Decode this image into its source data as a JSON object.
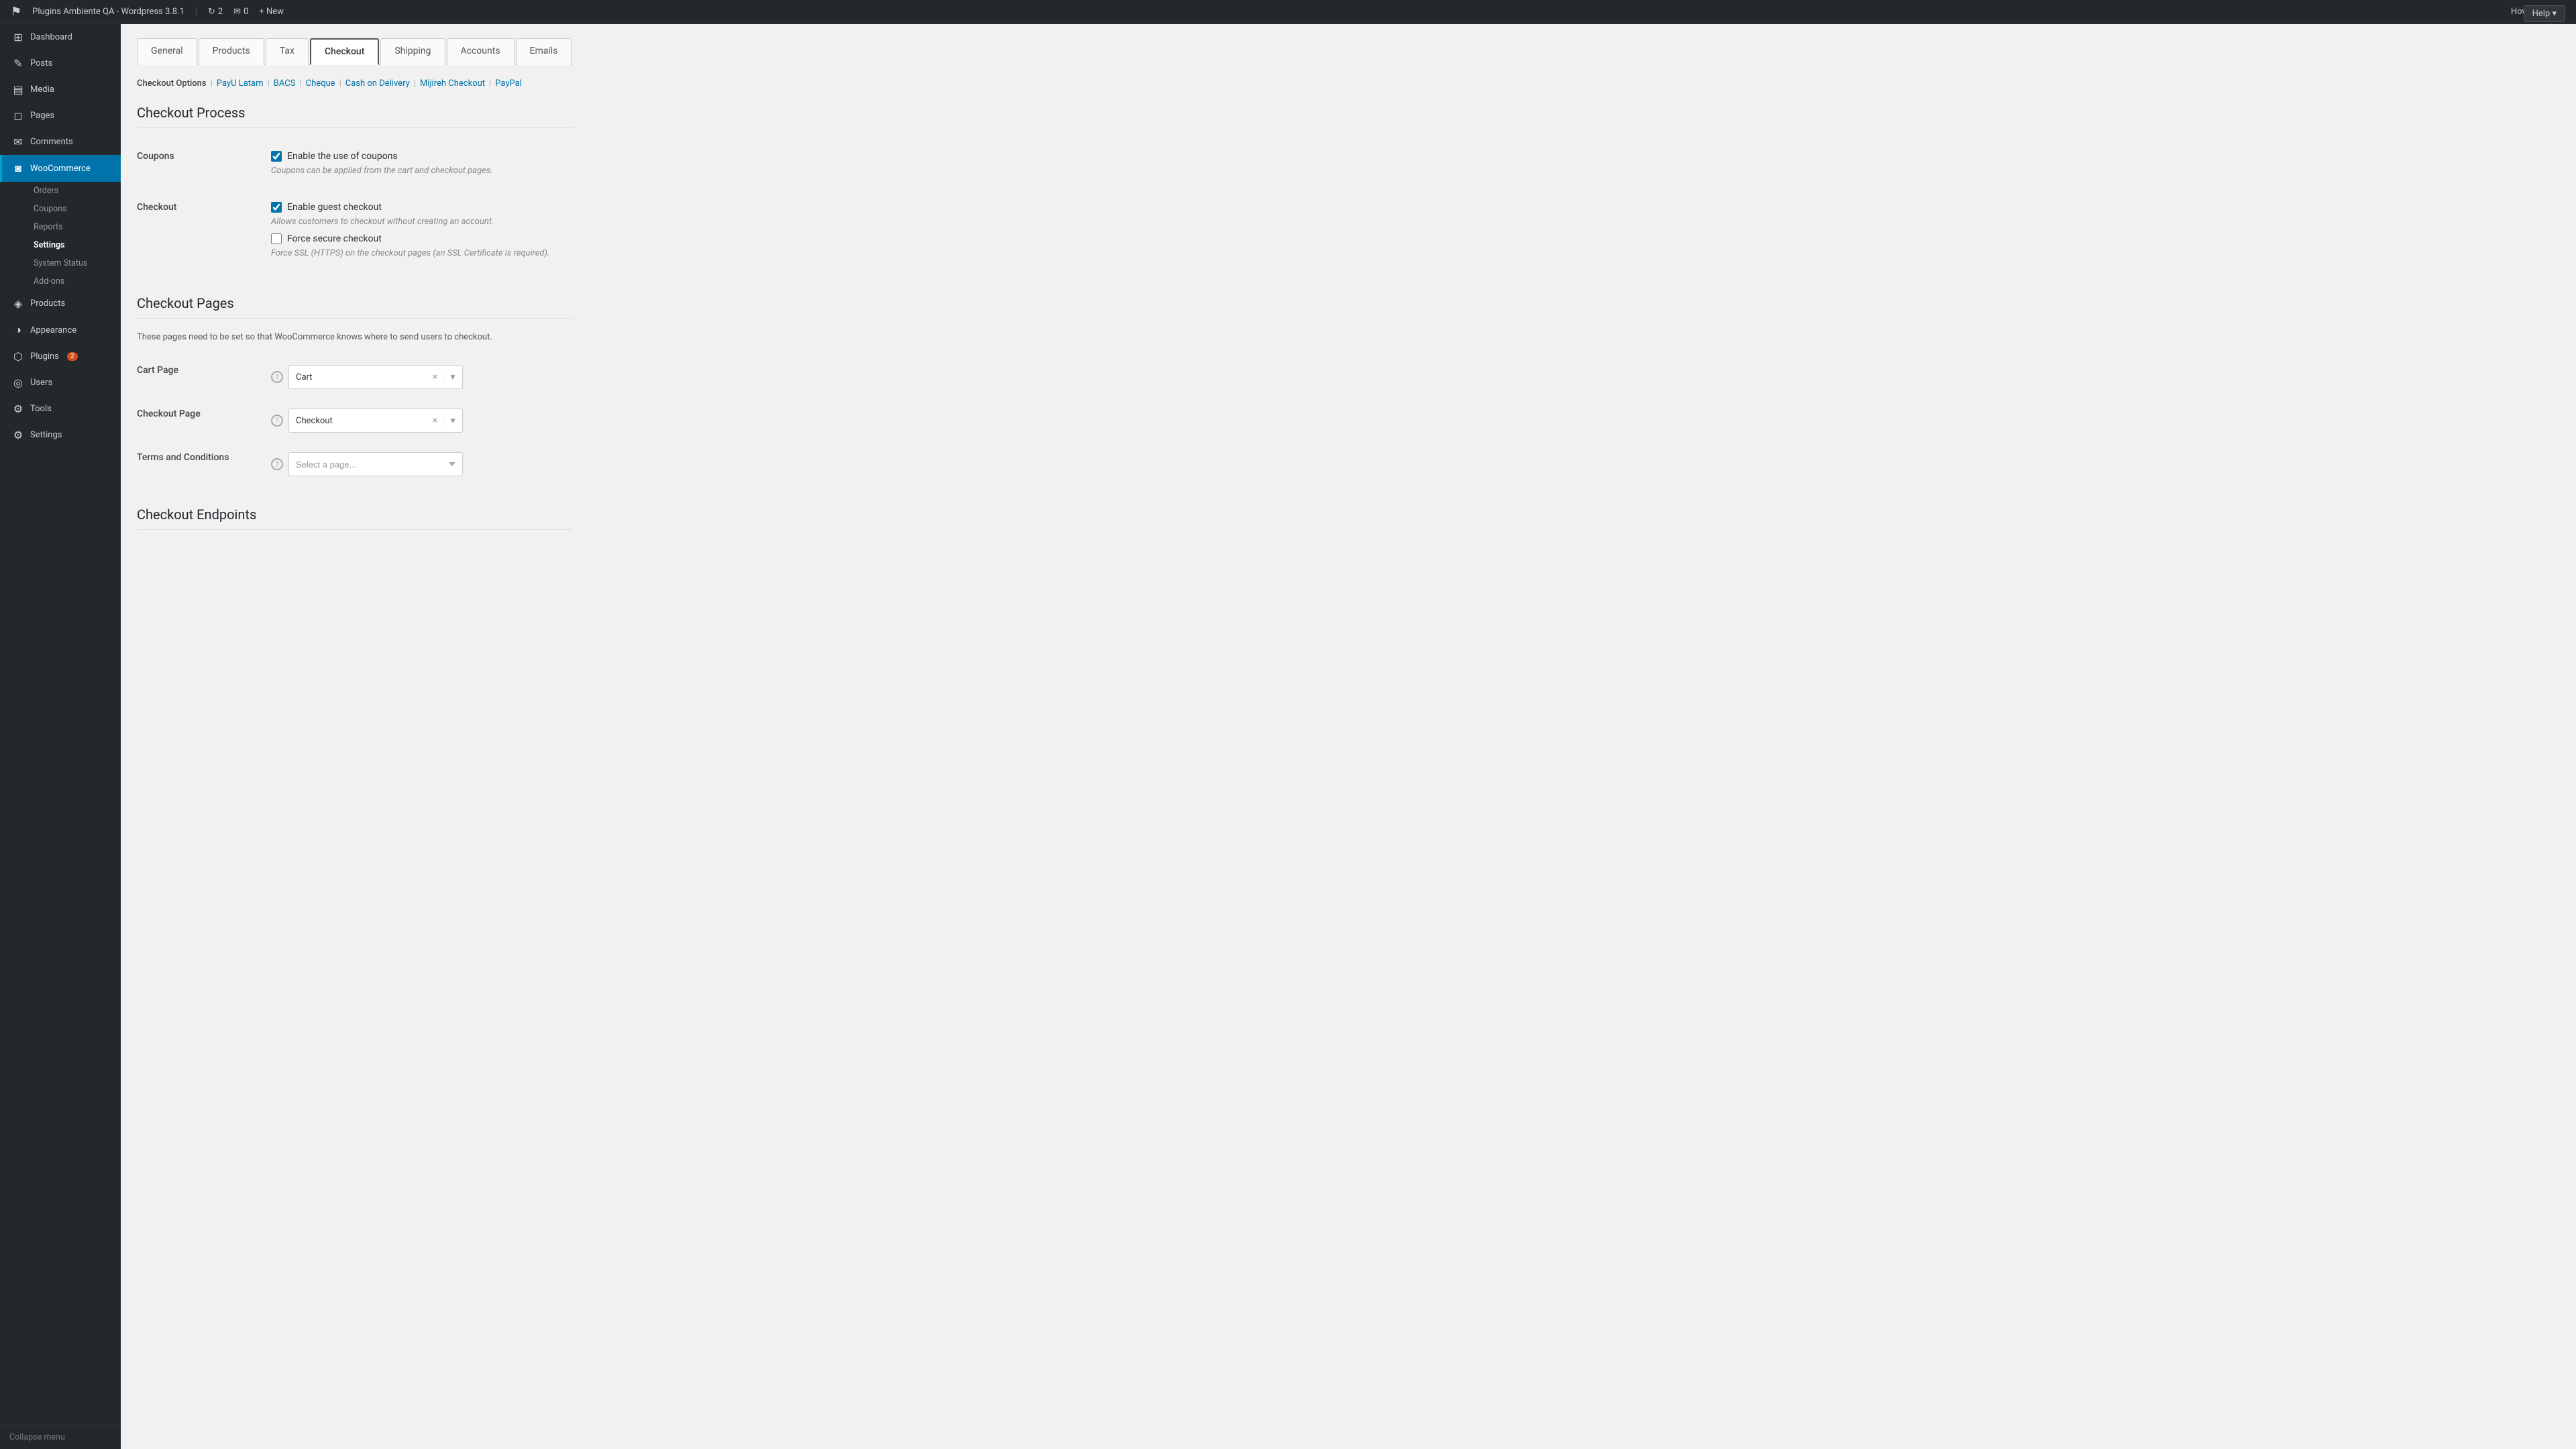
{
  "adminBar": {
    "wpIconLabel": "W",
    "siteName": "Plugins Ambiente QA - Wordpress 3.8.1",
    "updateCount": "2",
    "commentCount": "0",
    "newLabel": "+ New",
    "howdyLabel": "Howdy, admin",
    "helpLabel": "Help ▾"
  },
  "sidebar": {
    "logo": {
      "text": "W",
      "siteName": "Plugins Ambiente QA",
      "siteVersion": "Wordpress 3.8.1"
    },
    "mainItems": [
      {
        "id": "dashboard",
        "icon": "⊞",
        "label": "Dashboard"
      },
      {
        "id": "posts",
        "icon": "✎",
        "label": "Posts"
      },
      {
        "id": "media",
        "icon": "▤",
        "label": "Media"
      },
      {
        "id": "pages",
        "icon": "◻",
        "label": "Pages"
      },
      {
        "id": "comments",
        "icon": "✉",
        "label": "Comments"
      },
      {
        "id": "woocommerce",
        "icon": "◙",
        "label": "WooCommerce",
        "active": true
      },
      {
        "id": "products",
        "icon": "◈",
        "label": "Products"
      },
      {
        "id": "appearance",
        "icon": "◑",
        "label": "Appearance"
      },
      {
        "id": "plugins",
        "icon": "⬡",
        "label": "Plugins",
        "badge": "2"
      },
      {
        "id": "users",
        "icon": "◎",
        "label": "Users"
      },
      {
        "id": "tools",
        "icon": "⚙",
        "label": "Tools"
      },
      {
        "id": "settings",
        "icon": "⚙",
        "label": "Settings"
      }
    ],
    "wooSubItems": [
      {
        "id": "orders",
        "label": "Orders"
      },
      {
        "id": "coupons",
        "label": "Coupons"
      },
      {
        "id": "reports",
        "label": "Reports"
      },
      {
        "id": "woo-settings",
        "label": "Settings",
        "active": true
      },
      {
        "id": "system-status",
        "label": "System Status"
      },
      {
        "id": "add-ons",
        "label": "Add-ons"
      }
    ],
    "collapseLabel": "Collapse menu"
  },
  "tabs": [
    {
      "id": "general",
      "label": "General"
    },
    {
      "id": "products",
      "label": "Products"
    },
    {
      "id": "tax",
      "label": "Tax"
    },
    {
      "id": "checkout",
      "label": "Checkout",
      "active": true
    },
    {
      "id": "shipping",
      "label": "Shipping"
    },
    {
      "id": "accounts",
      "label": "Accounts"
    },
    {
      "id": "emails",
      "label": "Emails"
    }
  ],
  "checkoutOptions": {
    "label": "Checkout Options",
    "links": [
      {
        "id": "payu",
        "text": "PayU Latam"
      },
      {
        "id": "bacs",
        "text": "BACS"
      },
      {
        "id": "cheque",
        "text": "Cheque"
      },
      {
        "id": "cod",
        "text": "Cash on Delivery"
      },
      {
        "id": "mijireh",
        "text": "Mijireh Checkout"
      },
      {
        "id": "paypal",
        "text": "PayPal"
      }
    ]
  },
  "checkoutProcess": {
    "title": "Checkout Process",
    "coupons": {
      "label": "Coupons",
      "enableLabel": "Enable the use of coupons",
      "enableChecked": true,
      "helperText": "Coupons can be applied from the cart and checkout pages."
    },
    "checkout": {
      "label": "Checkout",
      "guestLabel": "Enable guest checkout",
      "guestChecked": true,
      "guestHelper": "Allows customers to checkout without creating an account.",
      "sslLabel": "Force secure checkout",
      "sslChecked": false,
      "sslHelper": "Force SSL (HTTPS) on the checkout pages (an SSL Certificate is required)."
    }
  },
  "checkoutPages": {
    "title": "Checkout Pages",
    "description": "These pages need to be set so that WooCommerce knows where to send users to checkout.",
    "cartPage": {
      "label": "Cart Page",
      "value": "Cart",
      "placeholder": "Cart"
    },
    "checkoutPage": {
      "label": "Checkout Page",
      "value": "Checkout",
      "placeholder": "Checkout"
    },
    "termsPage": {
      "label": "Terms and Conditions",
      "placeholder": "Select a page..."
    }
  },
  "checkoutEndpoints": {
    "title": "Checkout Endpoints"
  }
}
